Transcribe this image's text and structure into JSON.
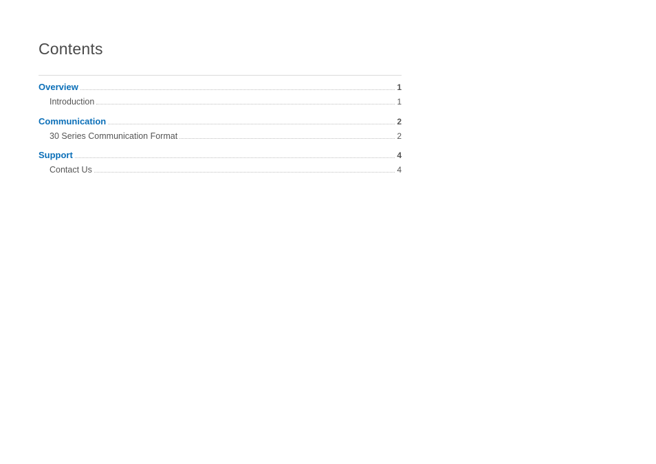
{
  "title": "Contents",
  "toc": [
    {
      "type": "section",
      "label": "Overview",
      "page": "1"
    },
    {
      "type": "sub",
      "label": "Introduction",
      "page": "1"
    },
    {
      "type": "section",
      "label": "Communication",
      "page": "2"
    },
    {
      "type": "sub",
      "label": "30 Series Communication Format",
      "page": "2"
    },
    {
      "type": "section",
      "label": "Support",
      "page": "4"
    },
    {
      "type": "sub",
      "label": "Contact Us",
      "page": "4"
    }
  ]
}
